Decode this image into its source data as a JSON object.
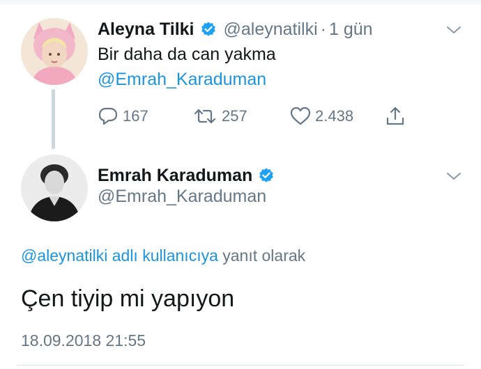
{
  "parent_tweet": {
    "author_name": "Aleyna Tilki",
    "handle": "@aleynatilki",
    "separator": "·",
    "time_ago": "1 gün",
    "text": "Bir daha da can yakma",
    "mention": "@Emrah_Karaduman",
    "actions": {
      "reply_icon": "reply-icon",
      "reply_count": "167",
      "retweet_icon": "retweet-icon",
      "retweet_count": "257",
      "like_icon": "heart-icon",
      "like_count": "2.438",
      "share_icon": "share-icon"
    }
  },
  "reply_tweet": {
    "author_name": "Emrah Karaduman",
    "handle": "@Emrah_Karaduman",
    "reply_context_link": "@aleynatilki adlı kullanıcıya",
    "reply_context_suffix": " yanıt olarak",
    "text": "Çen tiyip mi yapıyon",
    "timestamp": "18.09.2018 21:55"
  },
  "colors": {
    "link": "#1b95e0",
    "verified": "#1da1f2",
    "muted": "#657786",
    "text": "#14171a"
  }
}
